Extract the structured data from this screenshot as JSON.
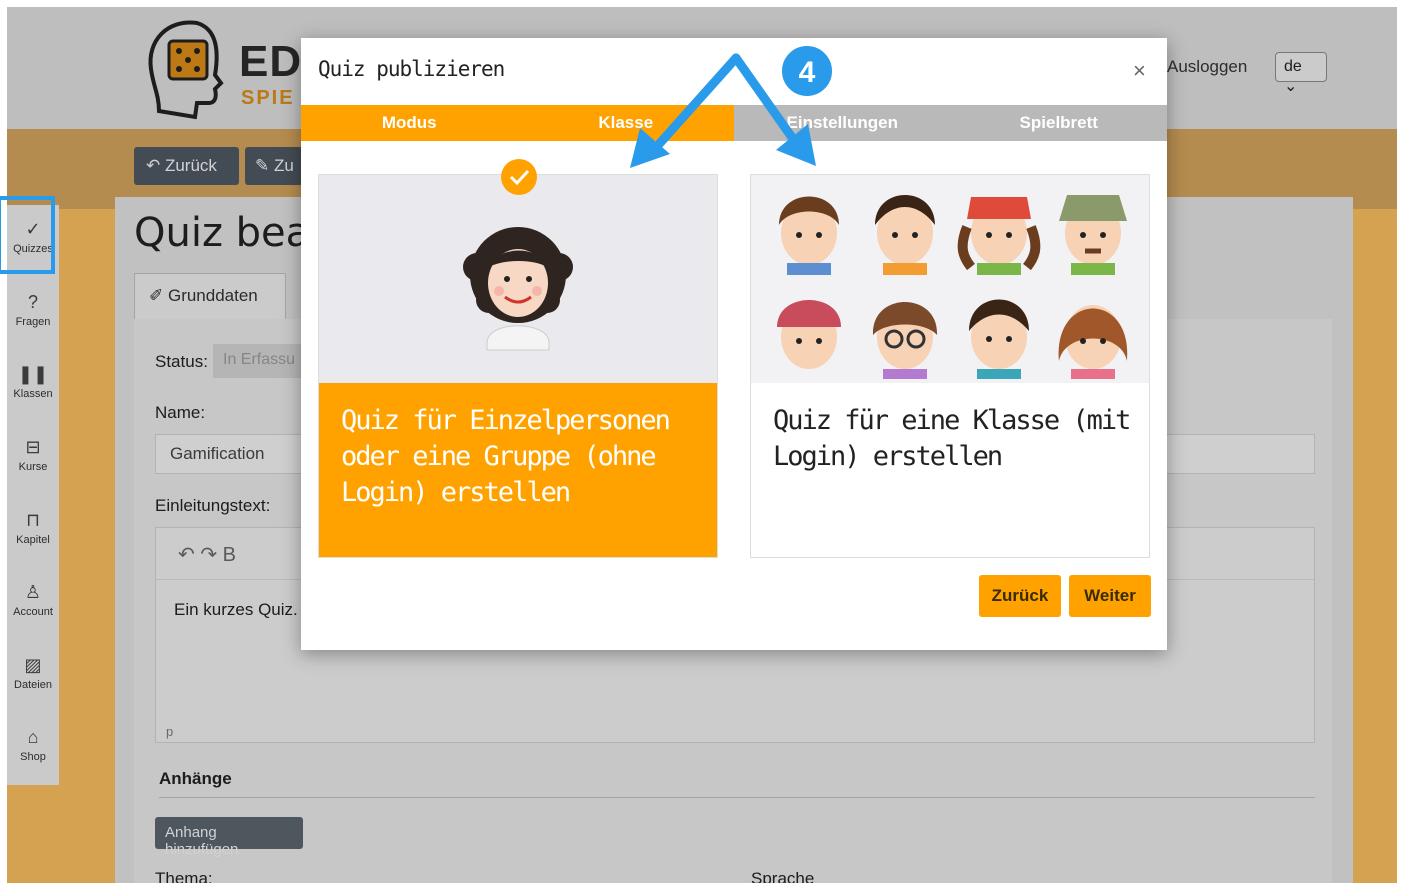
{
  "header": {
    "logo_text": "ED",
    "logo_sub": "SPIE",
    "logout": "Ausloggen",
    "language": "de ⌄"
  },
  "toolbar": {
    "back_label": "↶ Zurück",
    "back2_label": "✎ Zu"
  },
  "page": {
    "title": "Quiz bearb",
    "tab_grunddaten": "✐ Grunddaten",
    "status_label": "Status:",
    "status_value": "In Erfassu",
    "name_label": "Name:",
    "name_value": "Gamification",
    "intro_label": "Einleitungstext:",
    "editor_toolbar": "↶  ↷       B",
    "editor_text": "Ein kurzes Quiz.",
    "editor_footer": "p",
    "attachments_title": "Anhänge",
    "add_attachment": "Anhang hinzufügen",
    "thema_label": "Thema:",
    "sprache_label": "Sprache"
  },
  "sidebar": {
    "items": [
      {
        "icon": "✓",
        "label": "Quizzes"
      },
      {
        "icon": "?",
        "label": "Fragen"
      },
      {
        "icon": "❚❚",
        "label": "Klassen"
      },
      {
        "icon": "⊟",
        "label": "Kurse"
      },
      {
        "icon": "⊓",
        "label": "Kapitel"
      },
      {
        "icon": "♙",
        "label": "Account"
      },
      {
        "icon": "▨",
        "label": "Dateien"
      },
      {
        "icon": "⌂",
        "label": "Shop"
      }
    ]
  },
  "modal": {
    "title": "Quiz publizieren",
    "close": "×",
    "steps": [
      "Modus",
      "Klasse",
      "Einstellungen",
      "Spielbrett"
    ],
    "option_individual": "Quiz für Einzelpersonen oder eine Gruppe (ohne Login) erstellen",
    "option_class": "Quiz für eine Klasse (mit Login) erstellen",
    "back_button": "Zurück",
    "next_button": "Weiter"
  },
  "annotation": {
    "step_number": "4"
  },
  "colors": {
    "accent": "#ffa200",
    "highlight": "#2a9bea",
    "inactive_step": "#b9b9b9"
  }
}
